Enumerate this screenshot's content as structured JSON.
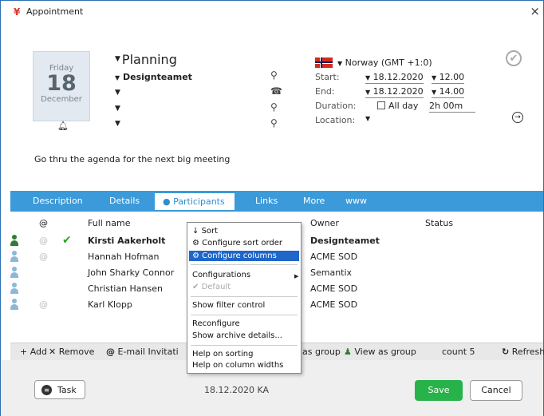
{
  "window": {
    "title": "Appointment",
    "close": "×"
  },
  "date": {
    "weekday": "Friday",
    "day": "18",
    "month": "December"
  },
  "appointment": {
    "type": "Planning",
    "owner": "Designteamet",
    "description": "Go thru the agenda for the next big meeting"
  },
  "schedule": {
    "timezone": "Norway (GMT +1:0)",
    "start_label": "Start:",
    "start_date": "18.12.2020",
    "start_time": "12.00",
    "end_label": "End:",
    "end_date": "18.12.2020",
    "end_time": "14.00",
    "duration_label": "Duration:",
    "allday_label": "All day",
    "duration": "2h 00m",
    "location_label": "Location:"
  },
  "tabs": [
    "Description",
    "Details",
    "Participants",
    "Links",
    "More",
    "www"
  ],
  "grid": {
    "headers": {
      "at": "@",
      "fullname": "Full name",
      "owner": "Owner",
      "status": "Status"
    },
    "rows": [
      {
        "name": "Kirsti Aakerholt",
        "owner": "Designteamet",
        "bold": true,
        "color": "#2e7d32",
        "at": "@",
        "tick": "✔"
      },
      {
        "name": "Hannah Hofman",
        "owner": "ACME SOD",
        "bold": false,
        "color": "#8ab8d6",
        "at": "@",
        "tick": ""
      },
      {
        "name": "John Sharky Connor",
        "owner": "Semantix",
        "bold": false,
        "color": "#8ab8d6",
        "at": "",
        "tick": ""
      },
      {
        "name": "Christian Hansen",
        "owner": "ACME SOD",
        "bold": false,
        "color": "#8ab8d6",
        "at": "",
        "tick": ""
      },
      {
        "name": "Karl Klopp",
        "owner": "ACME SOD",
        "bold": false,
        "color": "#8ab8d6",
        "at": "@",
        "tick": ""
      }
    ]
  },
  "toolbar": {
    "add": "Add",
    "remove": "Remove",
    "email": "E-mail Invitati",
    "as_group": "as group",
    "view_as_group": "View as group",
    "count": "count 5",
    "refresh": "Refresh"
  },
  "context_menu": {
    "sort": "Sort",
    "configure_sort": "Configure sort order",
    "configure_columns": "Configure columns",
    "configurations": "Configurations",
    "default": "Default",
    "show_filter": "Show filter control",
    "reconfigure": "Reconfigure",
    "show_archive": "Show archive details...",
    "help_sorting": "Help on sorting",
    "help_columns": "Help on column widths"
  },
  "footer": {
    "task": "Task",
    "info": "18.12.2020 KA",
    "save": "Save",
    "cancel": "Cancel"
  },
  "colors": {
    "accent": "#3b9ad9",
    "save": "#27b24a",
    "menu_highlight": "#1e66c9"
  }
}
